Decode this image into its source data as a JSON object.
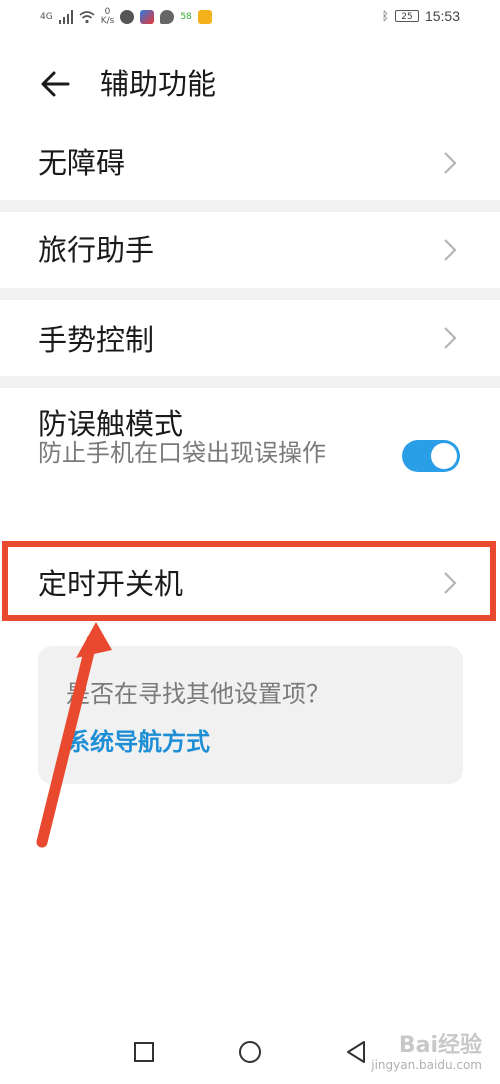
{
  "status_bar": {
    "network_type": "4G",
    "speed_value": "0",
    "speed_unit": "K/s",
    "app_badge": "58",
    "battery": "25",
    "time": "15:53"
  },
  "header": {
    "title": "辅助功能"
  },
  "rows": [
    {
      "label": "无障碍"
    },
    {
      "label": "旅行助手"
    },
    {
      "label": "手势控制"
    },
    {
      "label": "防误触模式",
      "subtitle": "防止手机在口袋出现误操作",
      "toggle_on": true
    },
    {
      "label": "定时开关机"
    }
  ],
  "search_card": {
    "question": "是否在寻找其他设置项？",
    "link": "系统导航方式"
  },
  "watermark": {
    "logo": "Bai经验",
    "url": "jingyan.baidu.com"
  },
  "colors": {
    "accent": "#2b9ee8",
    "link": "#1e8fd6",
    "annotation": "#e8492f",
    "divider": "#f1f1f1"
  }
}
